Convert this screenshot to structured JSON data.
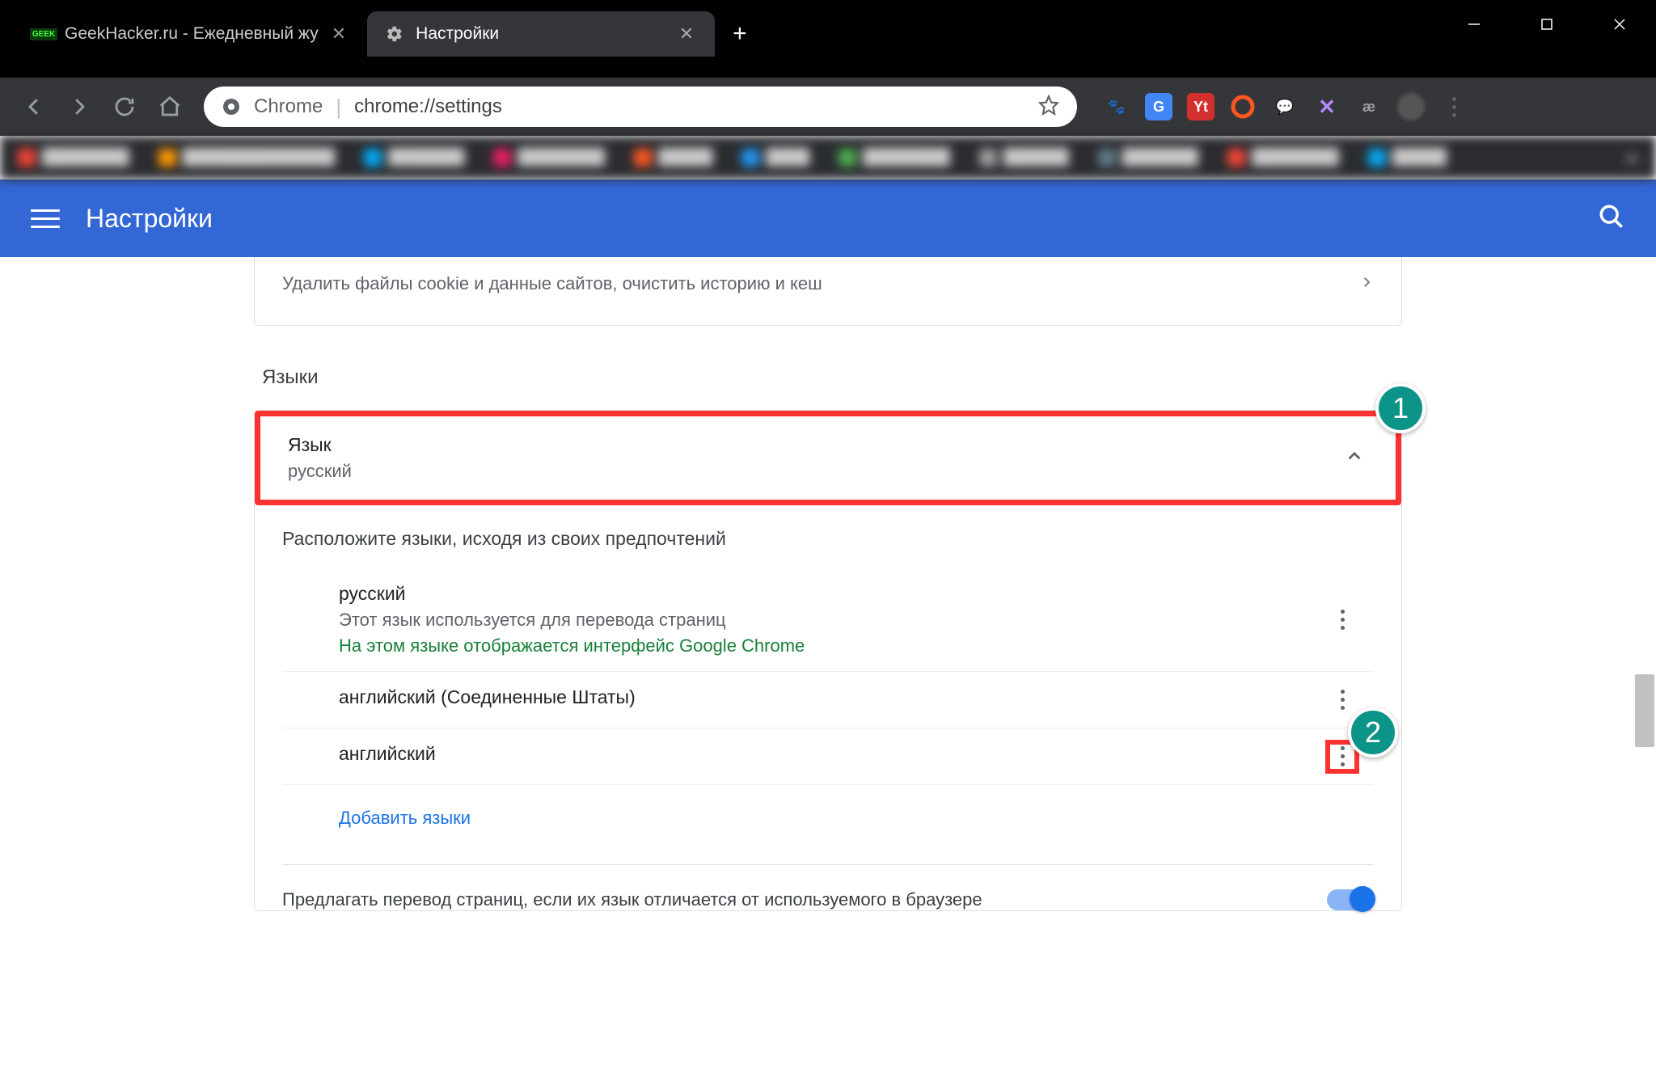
{
  "window": {
    "tabs": [
      {
        "title": "GeekHacker.ru - Ежедневный жу",
        "favicon": "GEEK"
      },
      {
        "title": "Настройки",
        "favicon": "gear"
      }
    ]
  },
  "toolbar": {
    "scheme_label": "Chrome",
    "url": "chrome://settings",
    "extensions": [
      "paw",
      "gt",
      "yt",
      "circle",
      "chat",
      "x",
      "ae"
    ]
  },
  "header": {
    "title": "Настройки"
  },
  "clear_card": {
    "subtitle": "Удалить файлы cookie и данные сайтов, очистить историю и кеш"
  },
  "section_languages": "Языки",
  "lang_header": {
    "title": "Язык",
    "subtitle": "русский"
  },
  "lang_body": {
    "instruction": "Расположите языки, исходя из своих предпочтений",
    "items": [
      {
        "name": "русский",
        "sub": "Этот язык используется для перевода страниц",
        "ui": "На этом языке отображается интерфейс Google Chrome"
      },
      {
        "name": "английский (Соединенные Штаты)"
      },
      {
        "name": "английский"
      }
    ],
    "add": "Добавить языки"
  },
  "translate_row": "Предлагать перевод страниц, если их язык отличается от используемого в браузере",
  "annotations": {
    "b1": "1",
    "b2": "2"
  }
}
